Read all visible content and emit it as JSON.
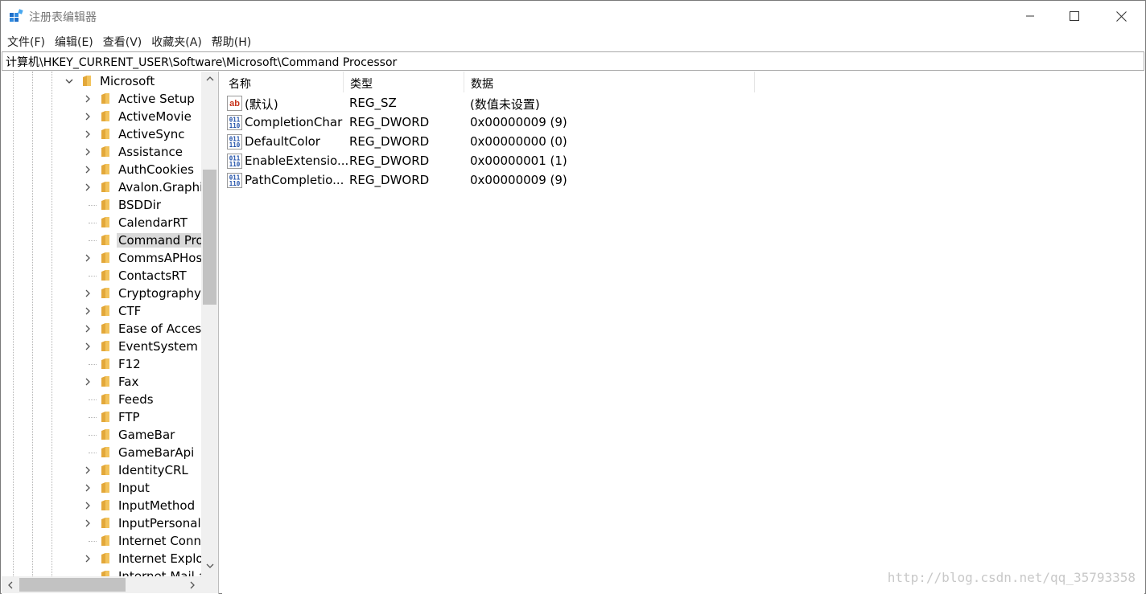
{
  "window": {
    "title": "注册表编辑器",
    "accent": "#0078d7"
  },
  "menu": [
    {
      "label": "文件(F)"
    },
    {
      "label": "编辑(E)"
    },
    {
      "label": "查看(V)"
    },
    {
      "label": "收藏夹(A)"
    },
    {
      "label": "帮助(H)"
    }
  ],
  "address": "计算机\\HKEY_CURRENT_USER\\Software\\Microsoft\\Command Processor",
  "tree": {
    "parent": {
      "label": "Microsoft",
      "expanded": true
    },
    "items": [
      {
        "label": "Active Setup",
        "expandable": true
      },
      {
        "label": "ActiveMovie",
        "expandable": true
      },
      {
        "label": "ActiveSync",
        "expandable": true
      },
      {
        "label": "Assistance",
        "expandable": true
      },
      {
        "label": "AuthCookies",
        "expandable": true
      },
      {
        "label": "Avalon.Graphi",
        "expandable": true
      },
      {
        "label": "BSDDir",
        "expandable": false
      },
      {
        "label": "CalendarRT",
        "expandable": false
      },
      {
        "label": "Command Pro",
        "expandable": false,
        "selected": true
      },
      {
        "label": "CommsAPHos",
        "expandable": true
      },
      {
        "label": "ContactsRT",
        "expandable": false
      },
      {
        "label": "Cryptography",
        "expandable": true
      },
      {
        "label": "CTF",
        "expandable": true
      },
      {
        "label": "Ease of Access",
        "expandable": true
      },
      {
        "label": "EventSystem",
        "expandable": true
      },
      {
        "label": "F12",
        "expandable": false
      },
      {
        "label": "Fax",
        "expandable": true
      },
      {
        "label": "Feeds",
        "expandable": false
      },
      {
        "label": "FTP",
        "expandable": false
      },
      {
        "label": "GameBar",
        "expandable": false
      },
      {
        "label": "GameBarApi",
        "expandable": false
      },
      {
        "label": "IdentityCRL",
        "expandable": true
      },
      {
        "label": "Input",
        "expandable": true
      },
      {
        "label": "InputMethod",
        "expandable": true
      },
      {
        "label": "InputPersonali",
        "expandable": true
      },
      {
        "label": "Internet Conn",
        "expandable": false
      },
      {
        "label": "Internet Explo",
        "expandable": true
      },
      {
        "label": "Internet Mail a",
        "expandable": false
      }
    ]
  },
  "list": {
    "columns": [
      {
        "label": "名称"
      },
      {
        "label": "类型"
      },
      {
        "label": "数据"
      }
    ],
    "rows": [
      {
        "name": "(默认)",
        "type": "REG_SZ",
        "data": "(数值未设置)",
        "icon": "string-value-icon"
      },
      {
        "name": "CompletionChar",
        "type": "REG_DWORD",
        "data": "0x00000009 (9)",
        "icon": "binary-value-icon"
      },
      {
        "name": "DefaultColor",
        "type": "REG_DWORD",
        "data": "0x00000000 (0)",
        "icon": "binary-value-icon"
      },
      {
        "name": "EnableExtensio...",
        "type": "REG_DWORD",
        "data": "0x00000001 (1)",
        "icon": "binary-value-icon"
      },
      {
        "name": "PathCompletio...",
        "type": "REG_DWORD",
        "data": "0x00000009 (9)",
        "icon": "binary-value-icon"
      }
    ]
  },
  "watermark": "http://blog.csdn.net/qq_35793358"
}
